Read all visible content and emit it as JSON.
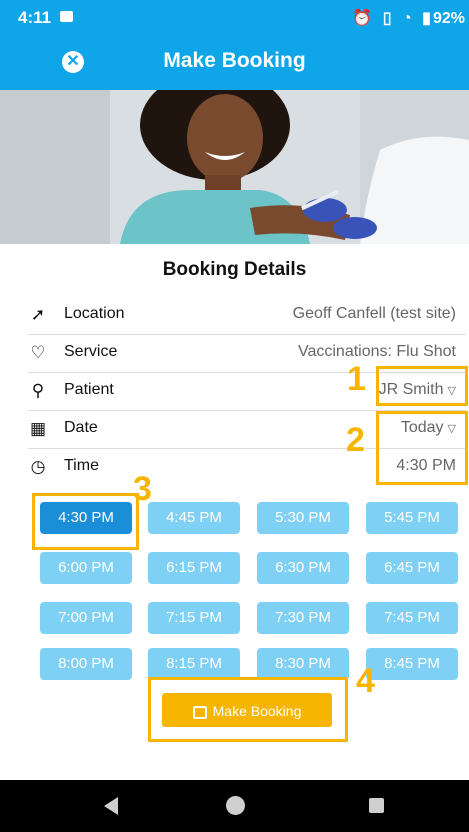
{
  "status_bar": {
    "time": "4:11",
    "icons": [
      "gallery-icon",
      "alarm-icon",
      "vibrate-icon",
      "wifi-icon",
      "battery-icon"
    ],
    "battery": "92%"
  },
  "app_bar": {
    "title": "Make Booking",
    "close_icon": "close-circle-icon"
  },
  "booking": {
    "section_title": "Booking Details",
    "rows": [
      {
        "icon": "location-arrow-icon",
        "label": "Location",
        "value": "Geoff Canfell (test site)"
      },
      {
        "icon": "heart-pulse-icon",
        "label": "Service",
        "value": "Vaccinations: Flu Shot"
      },
      {
        "icon": "user-icon",
        "label": "Patient",
        "value": "JR Smith"
      },
      {
        "icon": "calendar-icon",
        "label": "Date",
        "value": "Today"
      },
      {
        "icon": "clock-icon",
        "label": "Time",
        "value": "4:30 PM"
      }
    ]
  },
  "time_slots": [
    "4:30 PM",
    "4:45 PM",
    "5:30 PM",
    "5:45 PM",
    "6:00 PM",
    "6:15 PM",
    "6:30 PM",
    "6:45 PM",
    "7:00 PM",
    "7:15 PM",
    "7:30 PM",
    "7:45 PM",
    "8:00 PM",
    "8:15 PM",
    "8:30 PM",
    "8:45 PM"
  ],
  "selected_slot": "4:30 PM",
  "make_booking_button": "Make Booking",
  "annotations": [
    "1",
    "2",
    "3",
    "4"
  ],
  "colors": {
    "primary": "#0ea5e9",
    "slot": "#7fd0f5",
    "slot_selected": "#1a8fd8",
    "accent": "#f7b500"
  }
}
